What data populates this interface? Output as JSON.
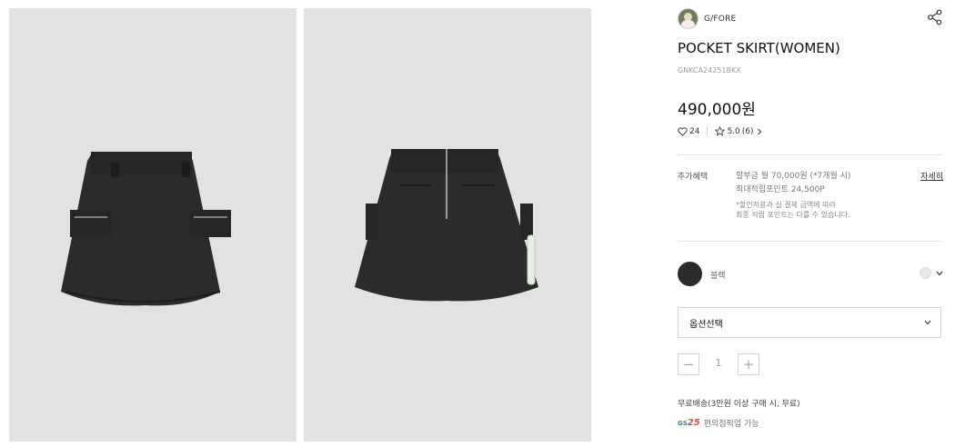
{
  "gallery": {
    "images": [
      {
        "name": "skirt-front-image",
        "alt": "front view"
      },
      {
        "name": "skirt-back-image",
        "alt": "back view"
      }
    ]
  },
  "brand": {
    "name": "G/FORE"
  },
  "product": {
    "title": "POCKET SKIRT(WOMEN)",
    "sku": "GNKCA24251BKX",
    "price": "490,000원",
    "likes": "24",
    "rating": "5.0",
    "review_count": "(6)"
  },
  "benefits": {
    "label": "추가혜택",
    "installment": "할부금 월 70,000원 (*7개월 시)",
    "points": "최대적립포인트 24,500P",
    "note_line1": "*할인적용과 실 결제 금액에 따라",
    "note_line2": "최종 적립 포인트는 다를 수 있습니다.",
    "detail_link": "자세히"
  },
  "color": {
    "name": "블랙",
    "swatch_hex": "#2b2b2d"
  },
  "option_select": {
    "label": "옵션선택"
  },
  "quantity": {
    "minus": "−",
    "value": "1",
    "plus": "+"
  },
  "shipping": {
    "text": "무료배송(3만원 이상 구매 시, 무료)"
  },
  "pickup": {
    "logo_gs": "GS",
    "logo_25": "25",
    "text": "편의점픽업 가능"
  },
  "icons": [
    "share-icon",
    "heart-icon",
    "star-icon",
    "chevron-right-icon",
    "chevron-down-icon"
  ]
}
